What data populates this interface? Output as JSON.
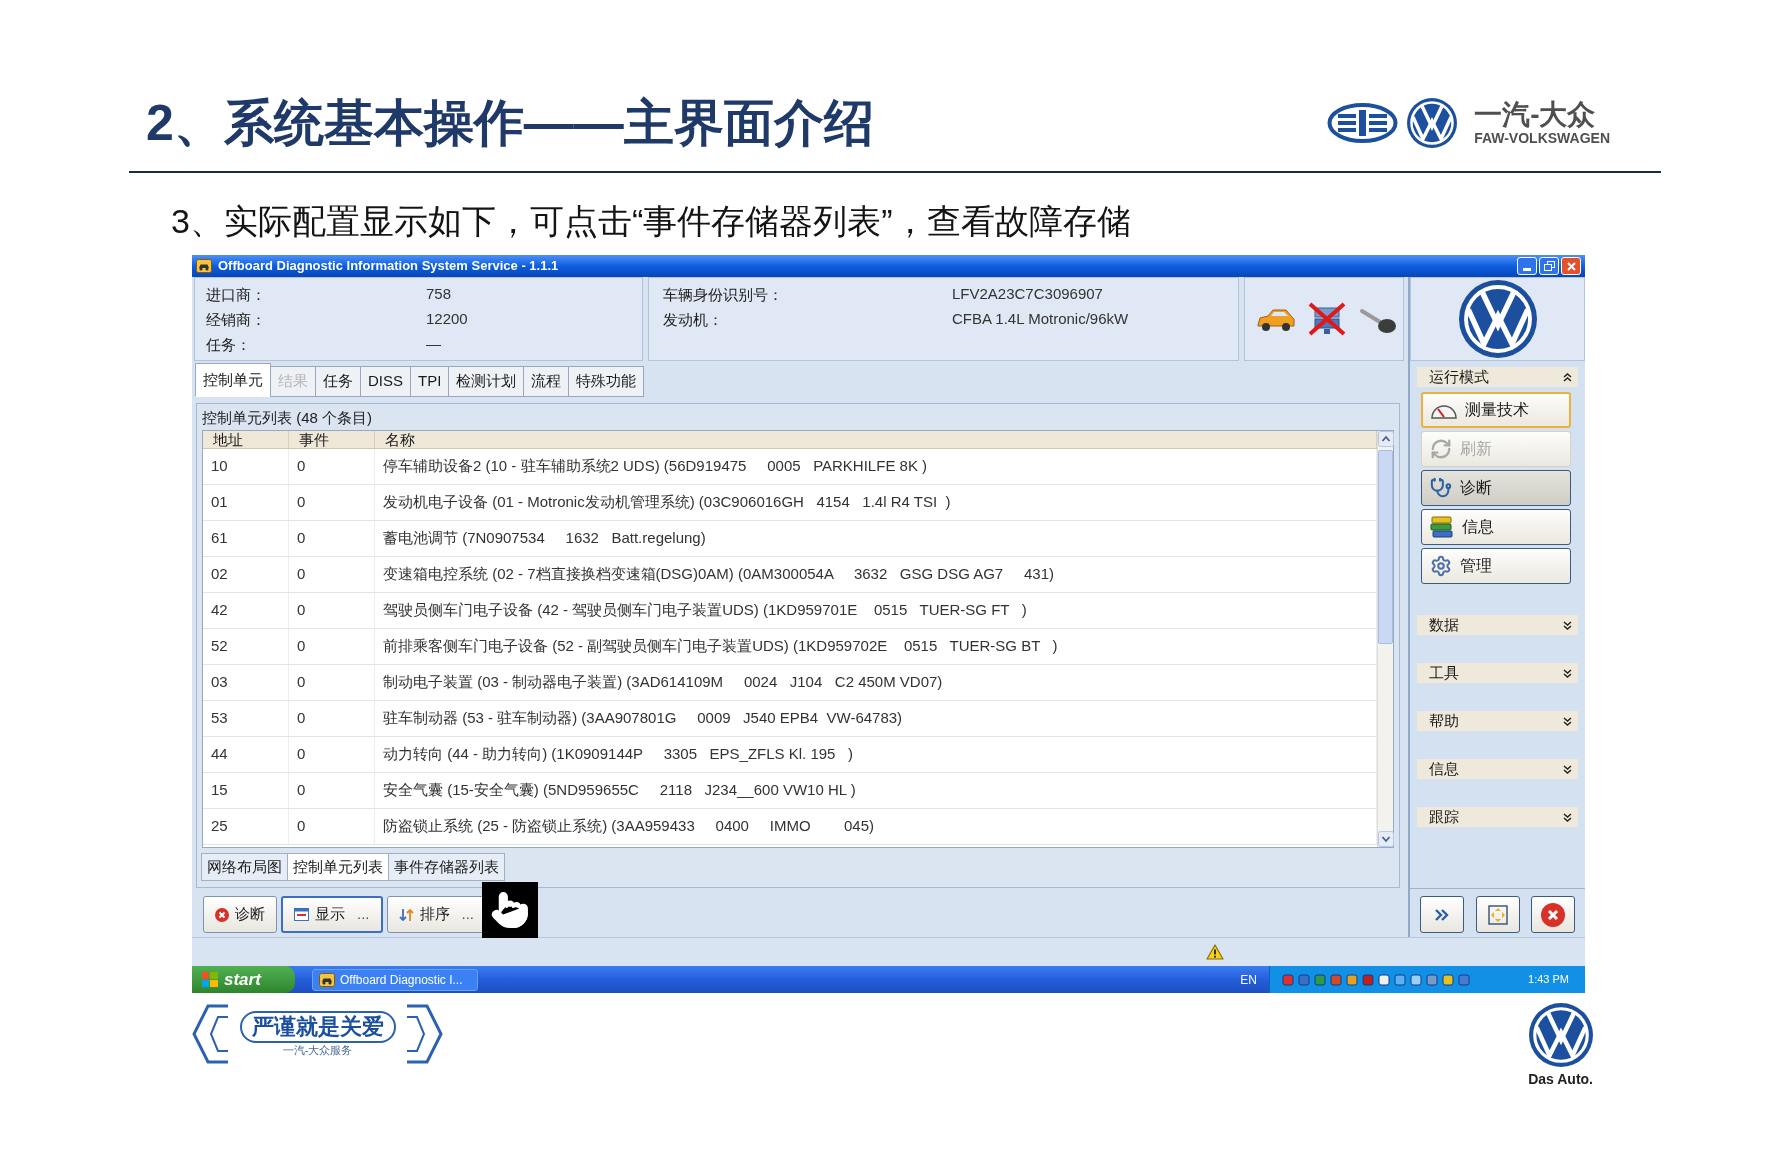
{
  "slide": {
    "title": "2、系统基本操作——主界面介绍",
    "subtitle": "3、实际配置显示如下，可点击“事件存储器列表”，查看故障存储"
  },
  "brand": {
    "name_cn": "一汽-大众",
    "name_en": "FAW-VOLKSWAGEN"
  },
  "window": {
    "title": "Offboard Diagnostic Information System Service - 1.1.1"
  },
  "dealer_info": [
    {
      "label": "进口商：",
      "value": "758"
    },
    {
      "label": "经销商：",
      "value": "12200"
    },
    {
      "label": "任务：",
      "value": "—"
    }
  ],
  "vehicle_info": [
    {
      "label": "车辆身份识别号：",
      "value": "LFV2A23C7C3096907"
    },
    {
      "label": "发动机：",
      "value": "CFBA 1.4L Motronic/96kW"
    }
  ],
  "status_icons": [
    {
      "kind": "car",
      "crossed": false
    },
    {
      "kind": "device",
      "crossed": true
    },
    {
      "kind": "key",
      "crossed": false
    }
  ],
  "tabs": [
    {
      "label": "控制单元",
      "selected": true,
      "disabled": false
    },
    {
      "label": "结果",
      "selected": false,
      "disabled": true
    },
    {
      "label": "任务",
      "selected": false,
      "disabled": false
    },
    {
      "label": "DISS",
      "selected": false,
      "disabled": false
    },
    {
      "label": "TPI",
      "selected": false,
      "disabled": false
    },
    {
      "label": "检测计划",
      "selected": false,
      "disabled": false
    },
    {
      "label": "流程",
      "selected": false,
      "disabled": false
    },
    {
      "label": "特殊功能",
      "selected": false,
      "disabled": false
    }
  ],
  "list_panel": {
    "title": "控制单元列表 (48 个条目)",
    "columns": [
      "地址",
      "事件",
      "名称"
    ],
    "rows": [
      [
        "10",
        "0",
        "停车辅助设备2 (10 - 驻车辅助系统2 UDS) (56D919475     0005   PARKHILFE 8K )"
      ],
      [
        "01",
        "0",
        "发动机电子设备 (01 - Motronic发动机管理系统) (03C906016GH   4154   1.4l R4 TSI  )"
      ],
      [
        "61",
        "0",
        "蓄电池调节 (7N0907534     1632   Batt.regelung)"
      ],
      [
        "02",
        "0",
        "变速箱电控系统 (02 - 7档直接换档变速箱(DSG)0AM) (0AM300054A     3632   GSG DSG AG7     431)"
      ],
      [
        "42",
        "0",
        "驾驶员侧车门电子设备 (42 - 驾驶员侧车门电子装置UDS) (1KD959701E    0515   TUER-SG FT   )"
      ],
      [
        "52",
        "0",
        "前排乘客侧车门电子设备 (52 - 副驾驶员侧车门电子装置UDS) (1KD959702E    0515   TUER-SG BT   )"
      ],
      [
        "03",
        "0",
        "制动电子装置 (03 - 制动器电子装置) (3AD614109M     0024   J104   C2 450M VD07)"
      ],
      [
        "53",
        "0",
        "驻车制动器 (53 - 驻车制动器) (3AA907801G     0009   J540 EPB4  VW-64783)"
      ],
      [
        "44",
        "0",
        "动力转向 (44 - 助力转向) (1K0909144P     3305   EPS_ZFLS Kl. 195   )"
      ],
      [
        "15",
        "0",
        "安全气囊 (15-安全气囊) (5ND959655C     2118   J234__600 VW10 HL )"
      ],
      [
        "25",
        "0",
        "防盗锁止系统 (25 - 防盗锁止系统) (3AA959433     0400     IMMO        045)"
      ]
    ]
  },
  "view_tabs": [
    {
      "label": "网络布局图",
      "selected": false
    },
    {
      "label": "控制单元列表",
      "selected": true
    },
    {
      "label": "事件存储器列表",
      "selected": false
    }
  ],
  "actions": [
    {
      "kind": "cancel",
      "label": "诊断",
      "focused": false
    },
    {
      "kind": "window",
      "label": "显示",
      "more": "...",
      "focused": true
    },
    {
      "kind": "sort",
      "label": "排序",
      "more": "...",
      "focused": false
    }
  ],
  "sidebar": {
    "sections": [
      {
        "label": "运行模式",
        "expanded": true,
        "buttons": [
          {
            "kind": "gauge",
            "label": "测量技术",
            "selected": false,
            "highlighted": true,
            "disabled": false
          },
          {
            "kind": "refresh",
            "label": "刷新",
            "selected": false,
            "highlighted": false,
            "disabled": true
          },
          {
            "kind": "stethoscope",
            "label": "诊断",
            "selected": true,
            "highlighted": false,
            "disabled": false
          },
          {
            "kind": "books",
            "label": "信息",
            "selected": false,
            "highlighted": false,
            "disabled": false
          },
          {
            "kind": "gear",
            "label": "管理",
            "selected": false,
            "highlighted": false,
            "disabled": false
          }
        ]
      },
      {
        "label": "数据",
        "expanded": false
      },
      {
        "label": "工具",
        "expanded": false
      },
      {
        "label": "帮助",
        "expanded": false
      },
      {
        "label": "信息",
        "expanded": false
      },
      {
        "label": "跟踪",
        "expanded": false
      }
    ]
  },
  "taskbar": {
    "start": "start",
    "task": "Offboard Diagnostic I...",
    "language": "EN",
    "clock": "1:43 PM"
  },
  "footer": {
    "slogan": "严谨就是关爱",
    "service": "一汽-大众服务",
    "tagline": "Das Auto."
  }
}
